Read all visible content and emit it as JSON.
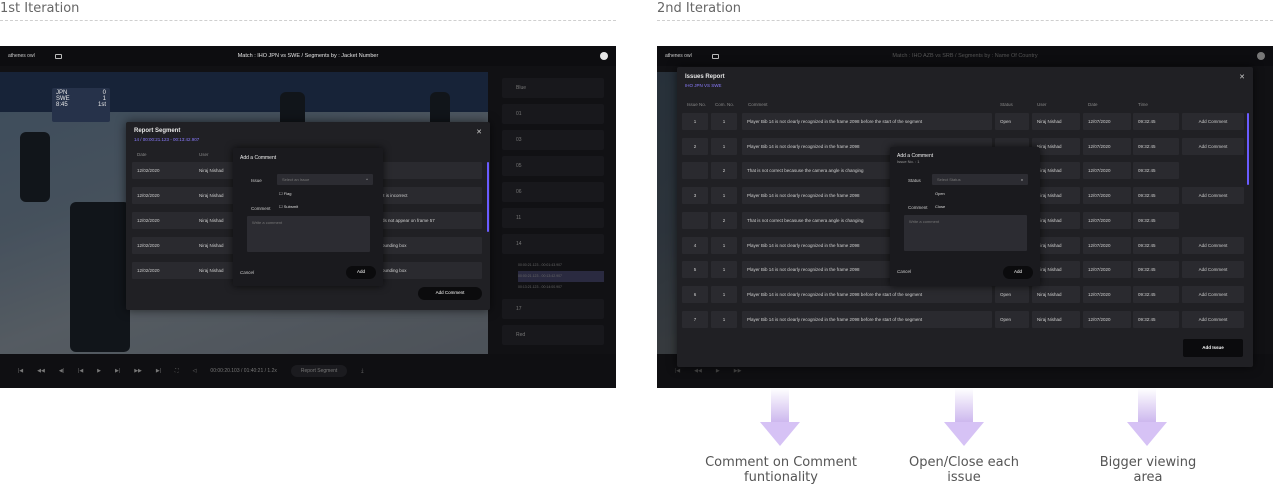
{
  "first": {
    "label": "1st Iteration",
    "logo": "athenes owl",
    "breadcrumb": "Match : IHO JPN vs SWE / Segments by : Jacket Number",
    "scoreboard": {
      "team1": "JPN",
      "score1": "0",
      "team2": "SWE",
      "score2": "1",
      "clock": "8:45",
      "period": "1st"
    },
    "sidebar": {
      "groups": [
        "Blue",
        "01",
        "03",
        "05",
        "06",
        "11",
        "14",
        "17",
        "Red"
      ],
      "segments": [
        "00:00:21.123 - 00:01:43.907",
        "00:00:21.123 - 00:13:42.907",
        "00:13:21.123 - 00:14:00.907"
      ]
    },
    "controls": {
      "time": "00:00:20.103 / 01:40:21 / 1.2x",
      "report_btn": "Report Segment"
    },
    "report": {
      "title": "Report Segment",
      "subtitle": "14  /  00:00:21.123 - 00:13:42.907",
      "headers": [
        "Date",
        "User"
      ],
      "rows": [
        {
          "date": "12/02/2020",
          "user": "Niraj Nishad",
          "comment": ""
        },
        {
          "date": "12/02/2020",
          "user": "Niraj Nishad",
          "comment": "2 is incorrect"
        },
        {
          "date": "12/02/2020",
          "user": "Niraj Nishad",
          "comment": "ds not appear on frame 57"
        },
        {
          "date": "12/02/2020",
          "user": "Niraj Nishad",
          "comment": "ounding box"
        },
        {
          "date": "12/02/2020",
          "user": "Niraj Nishad",
          "comment": "ounding box"
        }
      ],
      "add_comment_btn": "Add Comment"
    },
    "add_comment": {
      "title": "Add a Comment",
      "issue_label": "Issue",
      "issue_placeholder": "Select an Issue",
      "options": [
        "Flag",
        "Subsmit"
      ],
      "comment_label": "Comment",
      "comment_placeholder": "Write a comment",
      "cancel": "Cancel",
      "add": "Add"
    }
  },
  "second": {
    "label": "2nd Iteration",
    "breadcrumb": "Match : IHO AZB vs SRB / Segments by : Name Of Country",
    "issues": {
      "title": "Issues Report",
      "subtitle": "IHO JPN VS SWE",
      "headers": [
        "Issue No.",
        "Com. No.",
        "Comment",
        "Status",
        "User",
        "Date",
        "Time"
      ],
      "rows": [
        {
          "issue": "1",
          "com": "1",
          "comment": "Player Bib 14 is not clearly recognized in the frame 2098 before the start of the segment",
          "status": "Open",
          "user": "Niraj Nishad",
          "date": "12/07/2020",
          "time": "09:32:45",
          "action": "Add Comment"
        },
        {
          "issue": "2",
          "com": "1",
          "comment": "Player Bib 14 is not clearly recognized in the frame 2098",
          "status": "",
          "user": "Niraj Nishad",
          "date": "12/07/2020",
          "time": "09:32:45",
          "action": "Add Comment"
        },
        {
          "issue": "",
          "com": "2",
          "comment": "That is not correct becasuse the camera angle is changing",
          "status": "",
          "user": "Niraj Nishad",
          "date": "12/07/2020",
          "time": "09:32:45",
          "action": ""
        },
        {
          "issue": "3",
          "com": "1",
          "comment": "Player Bib 14 is not clearly recognized in the frame 2098",
          "status": "",
          "user": "Niraj Nishad",
          "date": "12/07/2020",
          "time": "09:32:45",
          "action": "Add Comment"
        },
        {
          "issue": "",
          "com": "2",
          "comment": "That is not correct becasuse the camera angle is changing",
          "status": "",
          "user": "Niraj Nishad",
          "date": "12/07/2020",
          "time": "09:32:45",
          "action": ""
        },
        {
          "issue": "4",
          "com": "1",
          "comment": "Player Bib 14 is not clearly recognized in the frame 2098",
          "status": "",
          "user": "Niraj Nishad",
          "date": "12/07/2020",
          "time": "09:32:45",
          "action": "Add Comment"
        },
        {
          "issue": "5",
          "com": "1",
          "comment": "Player Bib 14 is not clearly recognized in the frame 2098",
          "status": "",
          "user": "Niraj Nishad",
          "date": "12/07/2020",
          "time": "09:32:45",
          "action": "Add Comment"
        },
        {
          "issue": "6",
          "com": "1",
          "comment": "Player Bib 14 is not clearly recognized in the frame 2098 before the start of the segment",
          "status": "Open",
          "user": "Niraj Nishad",
          "date": "12/07/2020",
          "time": "09:32:45",
          "action": "Add Comment"
        },
        {
          "issue": "7",
          "com": "1",
          "comment": "Player Bib 14 is not clearly recognized in the frame 2098 before the start of the segment",
          "status": "Open",
          "user": "Niraj Nishad",
          "date": "12/07/2020",
          "time": "09:32:45",
          "action": "Add Comment"
        }
      ],
      "add_issue_btn": "Add Issue"
    },
    "add_comment": {
      "title": "Add a Comment",
      "issue_no": "Issue No. : 1",
      "status_label": "Status",
      "status_placeholder": "Select Status",
      "options": [
        "Open",
        "Close"
      ],
      "comment_label": "Comment",
      "comment_placeholder": "Write a comment",
      "cancel": "Cancel",
      "add": "Add"
    }
  },
  "captions": [
    "Comment on Comment funtionality",
    "Open/Close each issue",
    "Bigger viewing area"
  ]
}
